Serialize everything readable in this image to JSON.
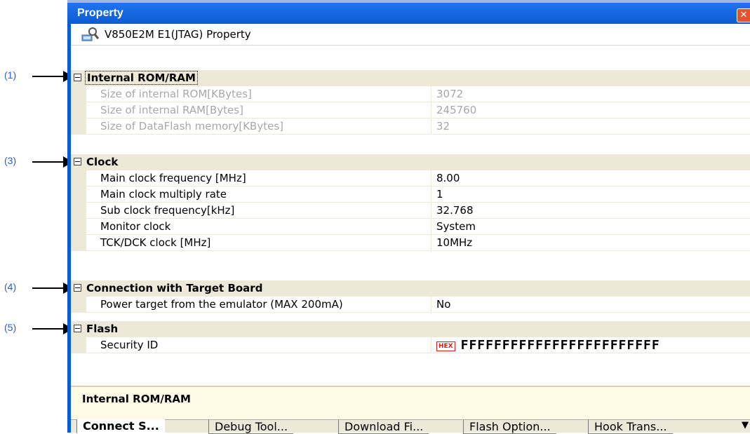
{
  "callouts": [
    {
      "label": "(1)"
    },
    {
      "label": "(3)"
    },
    {
      "label": "(4)"
    },
    {
      "label": "(5)"
    }
  ],
  "window": {
    "title": "Property",
    "close_icon": "close-icon"
  },
  "property_header": {
    "icon": "debug-tool-icon",
    "text": "V850E2M E1(JTAG) Property"
  },
  "categories": {
    "internal": {
      "label": "Internal ROM/RAM",
      "rows": [
        {
          "name": "Size of internal ROM[KBytes]",
          "value": "3072"
        },
        {
          "name": "Size of internal RAM[Bytes]",
          "value": "245760"
        },
        {
          "name": "Size of DataFlash memory[KBytes]",
          "value": "32"
        }
      ]
    },
    "clock": {
      "label": "Clock",
      "rows": [
        {
          "name": "Main clock frequency [MHz]",
          "value": "8.00"
        },
        {
          "name": "Main clock multiply rate",
          "value": "1"
        },
        {
          "name": "Sub clock frequency[kHz]",
          "value": "32.768"
        },
        {
          "name": "Monitor clock",
          "value": "System"
        },
        {
          "name": "TCK/DCK clock [MHz]",
          "value": "10MHz"
        }
      ]
    },
    "connection": {
      "label": "Connection with Target Board",
      "rows": [
        {
          "name": "Power target from the emulator (MAX 200mA)",
          "value": "No"
        }
      ]
    },
    "flash": {
      "label": "Flash",
      "rows": [
        {
          "name": "Security ID",
          "badge": "HEX",
          "value": "FFFFFFFFFFFFFFFFFFFFFFFF"
        }
      ]
    }
  },
  "description": {
    "text": "Internal ROM/RAM"
  },
  "tabs": [
    {
      "label": "Connect S..."
    },
    {
      "label": "Debug Tool..."
    },
    {
      "label": "Download Fi..."
    },
    {
      "label": "Flash Option..."
    },
    {
      "label": "Hook Trans..."
    }
  ],
  "tabs_more_icon": "overflow-arrow-icon"
}
